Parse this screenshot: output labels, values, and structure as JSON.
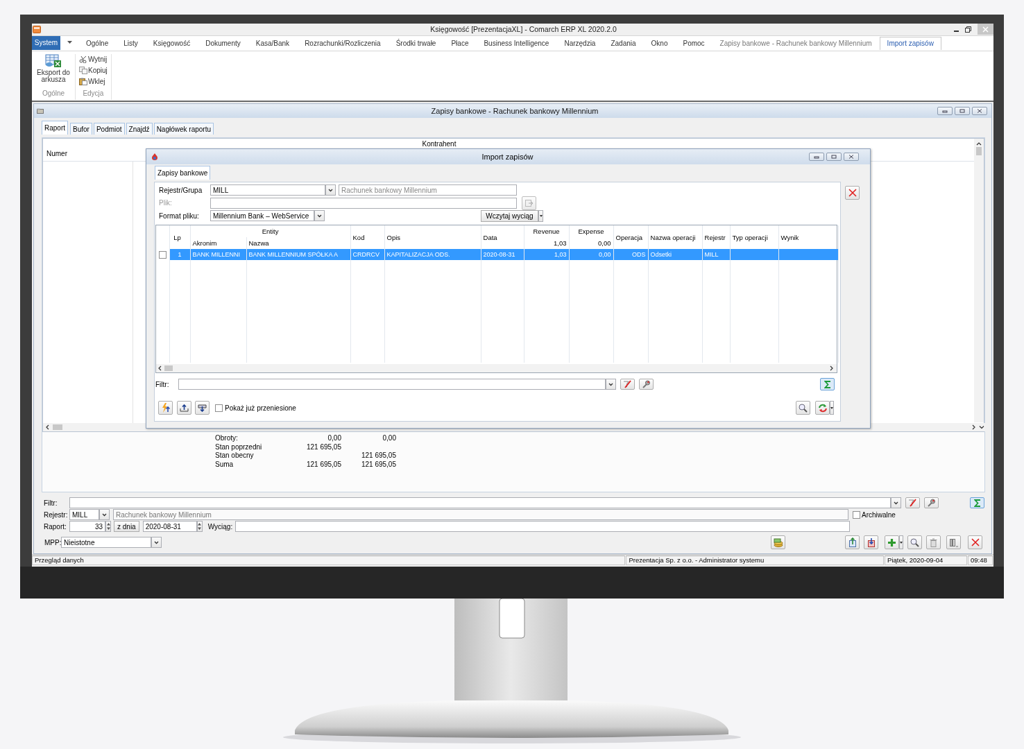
{
  "window": {
    "title": "Księgowość [PrezentacjaXL] - Comarch ERP XL 2020.2.0"
  },
  "menu": {
    "app_button": "System",
    "tabs": [
      {
        "label": "Ogólne",
        "kind": "tab",
        "selected": false
      },
      {
        "label": "Listy",
        "kind": "tab",
        "selected": false
      },
      {
        "label": "Księgowość",
        "kind": "tab",
        "selected": false
      },
      {
        "label": "Dokumenty",
        "kind": "tab",
        "selected": false
      },
      {
        "label": "Kasa/Bank",
        "kind": "tab",
        "selected": false
      },
      {
        "label": "Rozrachunki/Rozliczenia",
        "kind": "tab",
        "selected": false
      },
      {
        "label": "Środki trwałe",
        "kind": "tab",
        "selected": false
      },
      {
        "label": "Płace",
        "kind": "tab",
        "selected": false
      },
      {
        "label": "Business Intelligence",
        "kind": "tab",
        "selected": false
      },
      {
        "label": "Narzędzia",
        "kind": "tab",
        "selected": false
      },
      {
        "label": "Zadania",
        "kind": "tab",
        "selected": false
      },
      {
        "label": "Okno",
        "kind": "tab",
        "selected": false
      },
      {
        "label": "Pomoc",
        "kind": "tab",
        "selected": false
      },
      {
        "label": "Zapisy bankowe - Rachunek bankowy Millennium",
        "kind": "context",
        "selected": false
      },
      {
        "label": "Import zapisów",
        "kind": "context",
        "selected": true
      }
    ]
  },
  "ribbon": [
    {
      "label": "Ogólne",
      "items": [
        {
          "label": "Eksport do arkusza",
          "kind": "large"
        }
      ]
    },
    {
      "label": "Edycja",
      "items": [
        {
          "label": "Wytnij",
          "kind": "small"
        },
        {
          "label": "Kopiuj",
          "kind": "small"
        },
        {
          "label": "Wklej",
          "kind": "small"
        }
      ]
    }
  ],
  "document_window": {
    "title": "Zapisy bankowe - Rachunek bankowy Millennium",
    "tabs": [
      {
        "label": "Raport",
        "selected": true
      },
      {
        "label": "Bufor",
        "selected": false
      },
      {
        "label": "Podmiot",
        "selected": false
      },
      {
        "label": "Znajdź",
        "selected": false
      },
      {
        "label": "Nagłówek raportu",
        "selected": false
      }
    ],
    "table": {
      "group_header": "Kontrahent",
      "columns": [
        "Numer"
      ]
    },
    "summary": [
      {
        "label": "Obroty:",
        "col_1": "0,00",
        "col_2": "0,00"
      },
      {
        "label": "Stan poprzedni",
        "col_1": "121 695,05"
      },
      {
        "label": "Stan obecny",
        "col_2": "121 695,05"
      },
      {
        "label": "Suma",
        "col_1": "121 695,05",
        "col_2": "121 695,05"
      }
    ],
    "filter": {
      "label": "Filtr:"
    },
    "register": {
      "label": "Rejestr:",
      "value": "MILL",
      "name": "Rachunek bankowy Millennium"
    },
    "archived": {
      "label": "Archiwalne",
      "checked": false
    },
    "report": {
      "label": "Raport:",
      "number": "33",
      "date_button": "z dnia",
      "date": "2020-08-31"
    },
    "statement": {
      "label": "Wyciąg:"
    },
    "mpp": {
      "label": "MPP:",
      "value": "Nieistotne"
    }
  },
  "dialog": {
    "title": "Import zapisów",
    "tabs": [
      {
        "label": "Zapisy bankowe",
        "selected": true
      }
    ],
    "register": {
      "label": "Rejestr/Grupa",
      "value": "MILL",
      "name": "Rachunek bankowy Millennium"
    },
    "file": {
      "label": "Plik:",
      "disabled": true
    },
    "format": {
      "label": "Format pliku:",
      "value": "Millennium Bank – WebService"
    },
    "load_button": "Wczytaj wyciąg",
    "grid": {
      "entity_header": "Entity",
      "columns": [
        {
          "label": "Lp"
        },
        {
          "label": "Akronim"
        },
        {
          "label": "Nazwa"
        },
        {
          "label": "Kod"
        },
        {
          "label": "Opis"
        },
        {
          "label": "Data"
        },
        {
          "label": "Revenue",
          "total": "1,03"
        },
        {
          "label": "Expense",
          "total": "0,00"
        },
        {
          "label": "Operacja"
        },
        {
          "label": "Nazwa operacji"
        },
        {
          "label": "Rejestr"
        },
        {
          "label": "Typ operacji"
        },
        {
          "label": "Wynik"
        }
      ],
      "rows": [
        {
          "selected": true,
          "checked": false,
          "cells": [
            "1",
            "BANK MILLENNI",
            "BANK MILLENNIUM SPÓŁKA A",
            "CRDRCV",
            "KAPITALIZACJA ODS.",
            "2020-08-31",
            "1,03",
            "0,00",
            "ODS",
            "Odsetki",
            "MILL"
          ]
        }
      ]
    },
    "filter": {
      "label": "Filtr:"
    },
    "show_transferred": {
      "label": "Pokaż już przeniesione",
      "checked": false
    }
  },
  "status_bar": [
    "Przegląd danych",
    "Prezentacja Sp. z o.o. - Administrator systemu",
    "Piątek, 2020-09-04",
    "09:48"
  ]
}
